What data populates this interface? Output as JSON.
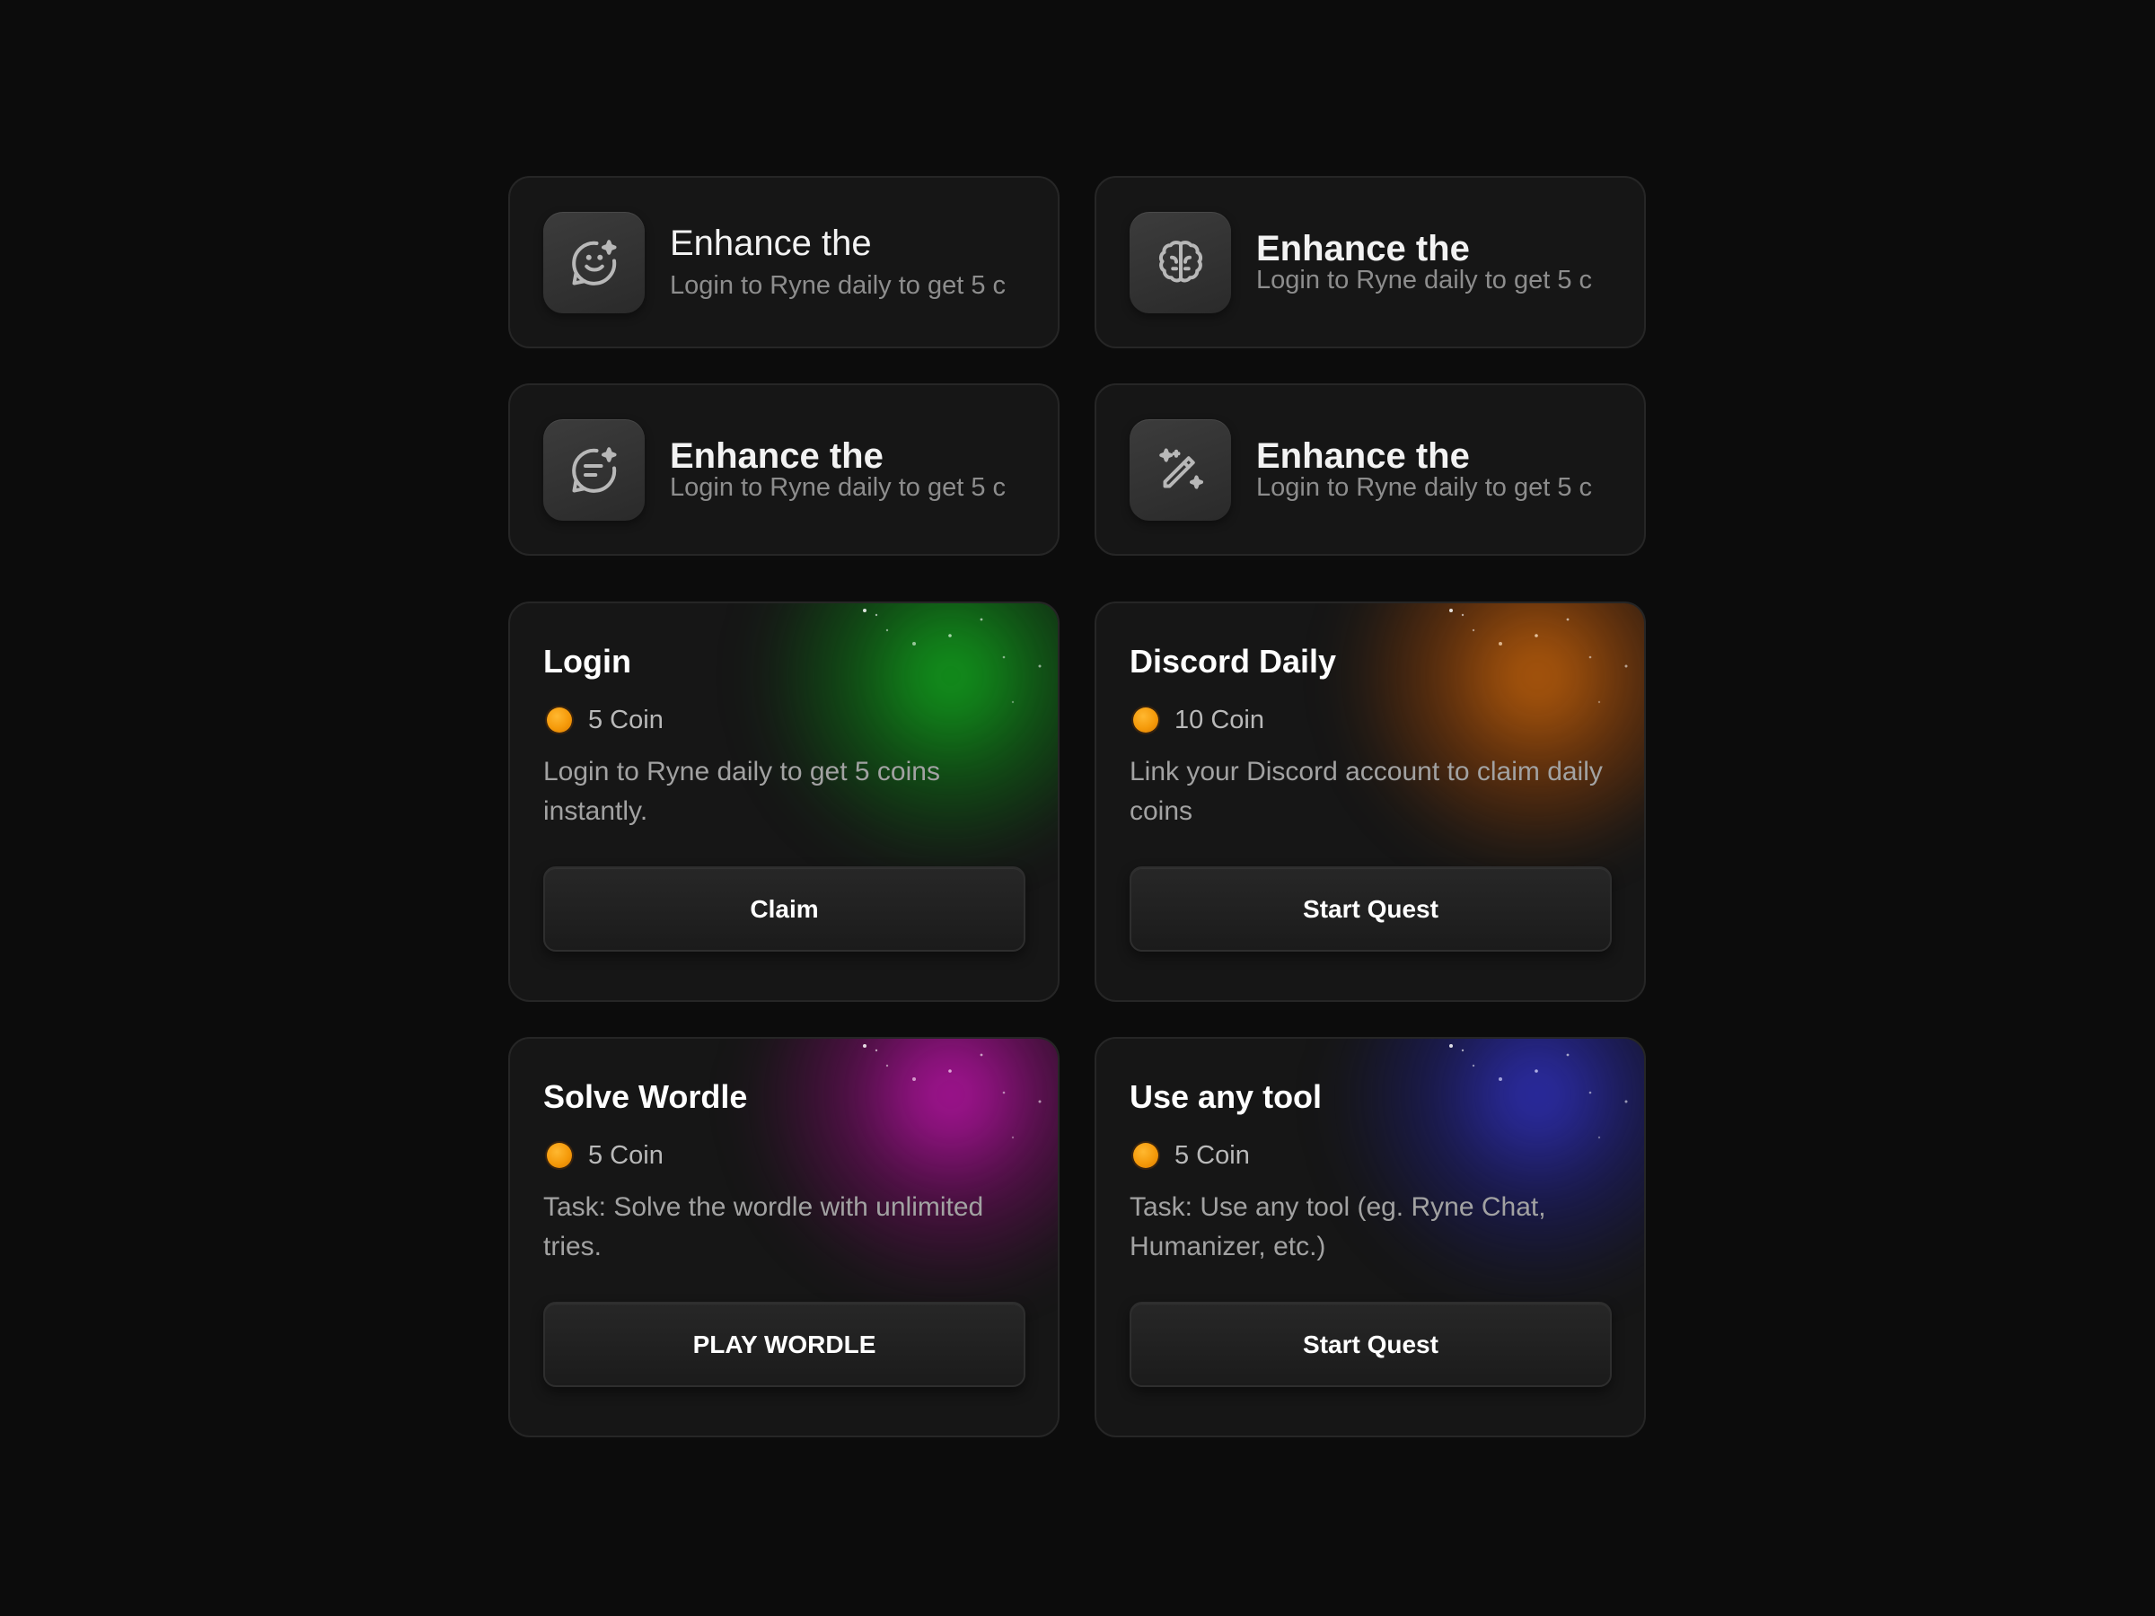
{
  "features": [
    {
      "icon": "smile-chat-sparkle-icon",
      "title": "Enhance the",
      "subtitle": "Login to Ryne daily to get 5 c"
    },
    {
      "icon": "brain-icon",
      "title": "Enhance the",
      "subtitle": "Login to Ryne daily to get 5 c"
    },
    {
      "icon": "message-sparkle-icon",
      "title": "Enhance the",
      "subtitle": "Login to Ryne daily to get 5 c"
    },
    {
      "icon": "magic-pen-icon",
      "title": "Enhance the",
      "subtitle": "Login to Ryne daily to get 5 c"
    }
  ],
  "quests": [
    {
      "title": "Login",
      "reward": "5 Coin",
      "description": "Login to Ryne daily to get 5 coins instantly.",
      "button": "Claim",
      "glow_color": "#12aa1e"
    },
    {
      "title": "Discord Daily",
      "reward": "10 Coin",
      "description": "Link your Discord account to claim daily coins",
      "button": "Start Quest",
      "glow_color": "#dc6e0a"
    },
    {
      "title": "Solve Wordle",
      "reward": "5 Coin",
      "description": "Task: Solve the wordle with unlimited tries.",
      "button": "PLAY WORDLE",
      "glow_color": "#c814b4"
    },
    {
      "title": "Use any tool",
      "reward": "5 Coin",
      "description": "Task: Use any tool (eg. Ryne Chat, Humanizer, etc.)",
      "button": "Start Quest",
      "glow_color": "#3232c8"
    }
  ],
  "colors": {
    "background": "#0c0c0c",
    "card": "#161616",
    "coin": "#f59a0a"
  }
}
